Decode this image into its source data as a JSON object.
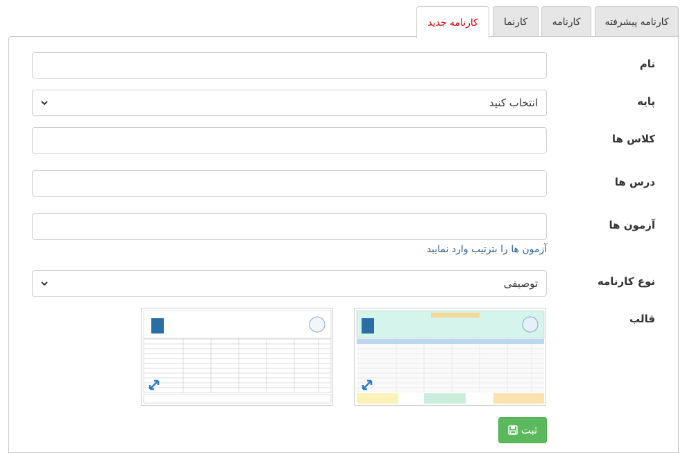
{
  "tabs": [
    {
      "label": "کارنامه پیشرفته",
      "active": false
    },
    {
      "label": "کارنامه",
      "active": false
    },
    {
      "label": "کارنما",
      "active": false
    },
    {
      "label": "کارنامه جدید",
      "active": true
    }
  ],
  "form": {
    "name_label": "نام",
    "name_value": "",
    "grade_label": "پایه",
    "grade_value": "انتخاب کنید",
    "classes_label": "کلاس ها",
    "classes_value": "",
    "lessons_label": "درس ها",
    "lessons_value": "",
    "exams_label": "آزمون ها",
    "exams_value": "",
    "exams_hint": "آزمون ها را بترتیب وارد نمایید",
    "type_label": "نوع کارنامه",
    "type_value": "توصیفی",
    "template_label": "قالب"
  },
  "templates": [
    {
      "name": "colored-template",
      "accent": "#cfe9f7",
      "header": "#fbe3a8",
      "green": "#c9efdc"
    },
    {
      "name": "plain-template",
      "accent": "#ffffff",
      "header": "#ffffff",
      "green": "#ffffff"
    }
  ],
  "save_button": {
    "label": "ثبت",
    "icon": "floppy-disk-icon"
  },
  "colors": {
    "active_tab_text": "#d40000",
    "hint_text": "#2a5d8f",
    "save_bg": "#5cb85c"
  }
}
